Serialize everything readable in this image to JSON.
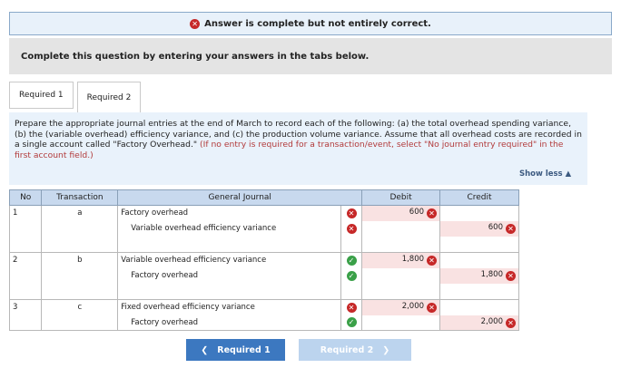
{
  "banner": {
    "status_icon": "x-circle-icon",
    "text": "Answer is complete but not entirely correct."
  },
  "instruction": "Complete this question by entering your answers in the tabs below.",
  "tabs": [
    {
      "label": "Required 1",
      "active": false
    },
    {
      "label": "Required 2",
      "active": true
    }
  ],
  "prompt": {
    "main": "Prepare the appropriate journal entries at the end of March to record each of the following: (a) the total overhead spending variance, (b) the (variable overhead) efficiency variance, and (c) the production volume variance. Assume that all overhead costs are recorded in a single account called \"Factory Overhead.\" ",
    "note": "(If no entry is required for a transaction/event, select \"No journal entry required\" in the first account field.)"
  },
  "show_less": "Show less",
  "table": {
    "headers": {
      "no": "No",
      "transaction": "Transaction",
      "general_journal": "General Journal",
      "debit": "Debit",
      "credit": "Credit"
    },
    "entries": [
      {
        "no": "1",
        "transaction": "a",
        "debit_line": {
          "account": "Factory overhead",
          "account_status": "wrong",
          "debit": "600",
          "debit_status": "wrong"
        },
        "credit_line": {
          "account": "Variable overhead efficiency variance",
          "account_status": "wrong",
          "credit": "600",
          "credit_status": "wrong"
        }
      },
      {
        "no": "2",
        "transaction": "b",
        "debit_line": {
          "account": "Variable overhead efficiency variance",
          "account_status": "correct",
          "debit": "1,800",
          "debit_status": "wrong"
        },
        "credit_line": {
          "account": "Factory overhead",
          "account_status": "correct",
          "credit": "1,800",
          "credit_status": "wrong"
        }
      },
      {
        "no": "3",
        "transaction": "c",
        "debit_line": {
          "account": "Fixed overhead efficiency variance",
          "account_status": "wrong",
          "debit": "2,000",
          "debit_status": "wrong"
        },
        "credit_line": {
          "account": "Factory overhead",
          "account_status": "correct",
          "credit": "2,000",
          "credit_status": "wrong"
        }
      }
    ]
  },
  "nav": {
    "prev_label": "Required 1",
    "next_label": "Required 2"
  },
  "colors": {
    "wrong": "#c62828",
    "correct": "#3aa048",
    "header_bg": "#c8d9ee",
    "prev_button": "#3c78c0",
    "next_button": "#bcd4ee"
  }
}
